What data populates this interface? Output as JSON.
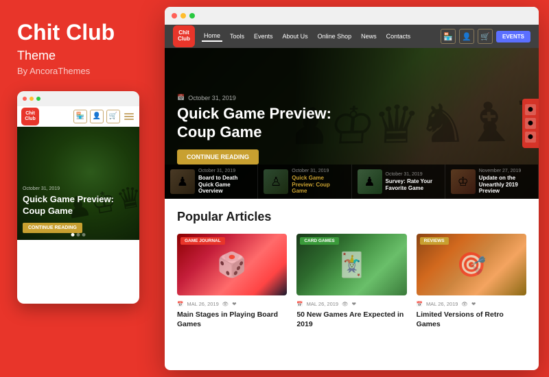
{
  "brand": {
    "title": "Chit Club",
    "subtitle": "Theme",
    "by": "By AncoraThemes"
  },
  "logo": {
    "line1": "Chit",
    "line2": "Club"
  },
  "nav": {
    "links": [
      {
        "label": "Home",
        "active": true
      },
      {
        "label": "Tools"
      },
      {
        "label": "Events"
      },
      {
        "label": "About Us"
      },
      {
        "label": "Online Shop"
      },
      {
        "label": "News"
      },
      {
        "label": "Contacts"
      }
    ],
    "events_button": "EVENTS"
  },
  "hero": {
    "date": "October 31, 2019",
    "title": "Quick Game Preview: Coup Game",
    "read_more": "CONTINUE READING"
  },
  "thumbnails": [
    {
      "date": "October 31, 2019",
      "title": "Board to Death Quick Game Overview"
    },
    {
      "date": "October 31, 2019",
      "title": "Quick Game Preview: Coup Game",
      "active": true
    },
    {
      "date": "October 31, 2019",
      "title": "Survey: Rate Your Favorite Game"
    },
    {
      "date": "November 27, 2019",
      "title": "Update on the Unearthly 2019 Preview"
    }
  ],
  "articles": {
    "section_title": "Popular Articles",
    "items": [
      {
        "badge": "GAME JOURNAL",
        "badge_class": "badge-game",
        "date": "MAL 26, 2019",
        "title": "Main Stages in Playing Board Games",
        "img_class": "article-img-1"
      },
      {
        "badge": "CARD GAMES",
        "badge_class": "badge-card",
        "date": "MAL 26, 2019",
        "title": "50 New Games Are Expected in 2019",
        "img_class": "article-img-2"
      },
      {
        "badge": "REVIEWS",
        "badge_class": "badge-review",
        "date": "MAL 26, 2019",
        "title": "Limited Versions of Retro Games",
        "img_class": "article-img-3"
      }
    ]
  },
  "mobile": {
    "hero_date": "October 31, 2019",
    "hero_title": "Quick Game Preview: Coup Game",
    "read_more": "CONTINUE READING"
  }
}
